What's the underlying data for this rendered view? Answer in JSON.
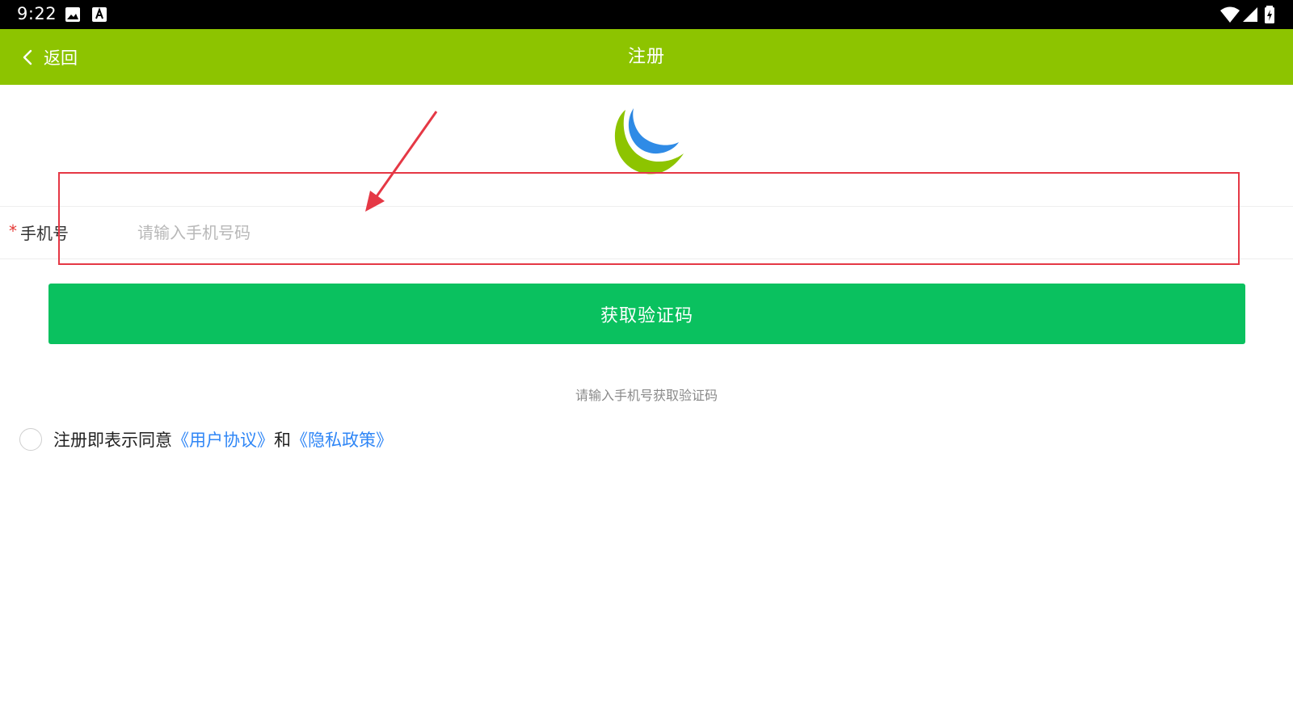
{
  "status_bar": {
    "time": "9:22",
    "left_icons": [
      "image-icon",
      "text-app-icon"
    ],
    "right_icons": [
      "wifi-icon",
      "signal-icon",
      "battery-charging-icon"
    ]
  },
  "app_bar": {
    "back_label": "返回",
    "title": "注册",
    "background_color": "#8dc400"
  },
  "form": {
    "phone_label": "手机号",
    "required_mark": "*",
    "phone_value": "",
    "phone_placeholder": "请输入手机号码"
  },
  "actions": {
    "get_code_label": "获取验证码",
    "button_color": "#0ac15f"
  },
  "hint": "请输入手机号获取验证码",
  "agreement": {
    "checked": false,
    "prefix": "注册即表示同意",
    "user_agreement_link": "《用户协议》",
    "conjunction": "和",
    "privacy_policy_link": "《隐私政策》",
    "link_color": "#2f86f6"
  },
  "annotation": {
    "highlight_color": "#e53845"
  }
}
